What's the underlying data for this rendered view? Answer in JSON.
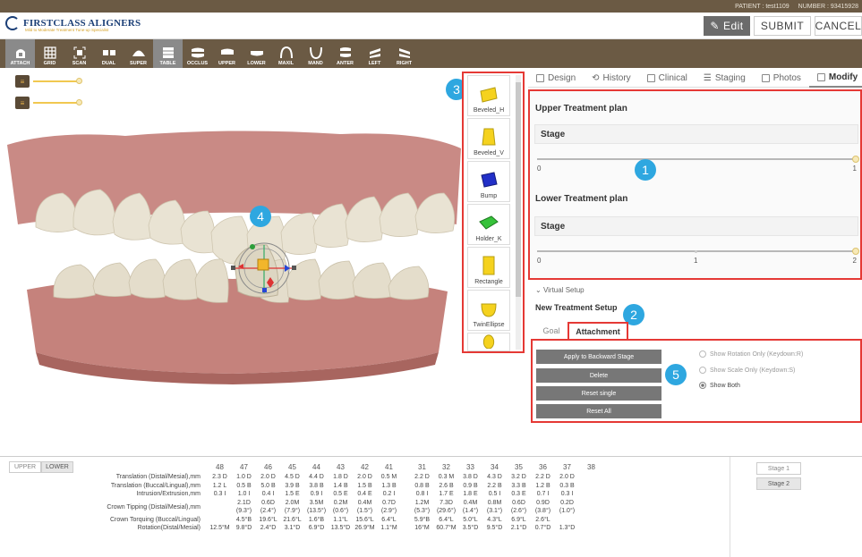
{
  "patient": {
    "label": "PATIENT : test1109",
    "number": "NUMBER : 93415928"
  },
  "brand": {
    "name": "FIRSTCLASS ALIGNERS",
    "tagline": "Mild to Moderate Treatment Tune-up Specialist"
  },
  "header": {
    "edit": "Edit",
    "submit": "SUBMIT",
    "cancel": "CANCEL"
  },
  "toolbar": [
    "ATTACH",
    "GRID",
    "SCAN",
    "DUAL",
    "SUPER",
    "TABLE",
    "OCCLUS",
    "UPPER",
    "LOWER",
    "MAXIL",
    "MAND",
    "ANTER",
    "LEFT",
    "RIGHT"
  ],
  "callouts": [
    "1",
    "2",
    "3",
    "4",
    "5"
  ],
  "palette": [
    "Beveled_H",
    "Beveled_V",
    "Bump",
    "Holder_K",
    "Rectangle",
    "TwinEllipse"
  ],
  "tabs": [
    "Design",
    "History",
    "Clinical",
    "Staging",
    "Photos",
    "Modify"
  ],
  "upper_plan": {
    "title": "Upper Treatment plan",
    "stage": "Stage",
    "min": "0",
    "max": "1",
    "value": 1
  },
  "lower_plan": {
    "title": "Lower Treatment plan",
    "stage": "Stage",
    "min": "0",
    "mid": "1",
    "max": "2",
    "value": 2
  },
  "virtual_setup": "Virtual Setup",
  "new_setup": "New Treatment Setup",
  "subtabs": {
    "goal": "Goal",
    "attachment": "Attachment"
  },
  "actions": [
    "Apply to Backward Stage",
    "Delete",
    "Reset single",
    "Reset All"
  ],
  "radios": [
    {
      "label": "Show Rotation Only (Keydown:R)",
      "checked": false
    },
    {
      "label": "Show Scale Only (Keydown:S)",
      "checked": false
    },
    {
      "label": "Show Both",
      "checked": true
    }
  ],
  "jaw_tabs": [
    "UPPER",
    "LOWER"
  ],
  "stages": [
    "Stage 1",
    "Stage 2"
  ],
  "table": {
    "teeth": [
      "48",
      "47",
      "46",
      "45",
      "44",
      "43",
      "42",
      "41",
      "31",
      "32",
      "33",
      "34",
      "35",
      "36",
      "37",
      "38"
    ],
    "rows": [
      {
        "label": "Translation (Distal/Mesial),mm",
        "cells": [
          "2.3 D",
          "1.0 D",
          "2.0 D",
          "4.5 D",
          "4.4 D",
          "1.8 D",
          "2.0 D",
          "0.5 M",
          "2.2 D",
          "0.3 M",
          "3.8 D",
          "4.3 D",
          "3.2 D",
          "2.2 D",
          "2.0 D",
          ""
        ]
      },
      {
        "label": "Translation (Buccal/Lingual),mm",
        "cells": [
          "1.2 L",
          "0.5 B",
          "5.0 B",
          "3.9 B",
          "3.8 B",
          "1.4 B",
          "1.5 B",
          "1.3 B",
          "0.8 B",
          "2.6 B",
          "0.9 B",
          "2.2 B",
          "3.3 B",
          "1.2 B",
          "0.3 B",
          ""
        ]
      },
      {
        "label": "Intrusion/Extrusion,mm",
        "cells": [
          "0.3 I",
          "1.0 I",
          "0.4 I",
          "1.5 E",
          "0.9 I",
          "0.5 E",
          "0.4 E",
          "0.2 I",
          "0.8 I",
          "1.7 E",
          "1.8 E",
          "0.5 I",
          "0.3 E",
          "0.7 I",
          "0.3 I",
          ""
        ]
      },
      {
        "label": "Crown Tipping (Distal/Mesial),mm",
        "cells": [
          "",
          "2.1D",
          "0.6D",
          "2.0M",
          "3.5M",
          "0.2M",
          "0.4M",
          "0.7D",
          "1.2M",
          "7.3D",
          "0.4M",
          "0.8M",
          "0.6D",
          "0.9D",
          "0.2D",
          ""
        ],
        "sub": [
          "",
          "(9.3°)",
          "(2.4°)",
          "(7.9°)",
          "(13.5°)",
          "(0.6°)",
          "(1.5°)",
          "(2.9°)",
          "(5.3°)",
          "(29.6°)",
          "(1.4°)",
          "(3.1°)",
          "(2.6°)",
          "(3.8°)",
          "(1.0°)",
          ""
        ]
      },
      {
        "label": "Crown Torquing (Buccal/Lingual)",
        "cells": [
          "",
          "4.5°B",
          "19.6°L",
          "21.6°L",
          "1.6°B",
          "1.1°L",
          "15.6°L",
          "6.4°L",
          "5.9°B",
          "6.4°L",
          "5.0°L",
          "4.3°L",
          "6.9°L",
          "2.6°L",
          "",
          ""
        ]
      },
      {
        "label": "Rotation(Distal/Mesial)",
        "cells": [
          "12.5°M",
          "9.8°D",
          "2.4°D",
          "3.1°D",
          "6.9°D",
          "13.5°D",
          "26.9°M",
          "1.1°M",
          "16°M",
          "60.7°M",
          "3.5°D",
          "9.5°D",
          "2.1°D",
          "0.7°D",
          "1.3°D",
          ""
        ]
      }
    ]
  },
  "colors": {
    "brown": "#6b5a44",
    "red": "#e53935",
    "blue": "#2ea7e0",
    "gum": "#c98a85",
    "tooth": "#e9e3d3"
  }
}
